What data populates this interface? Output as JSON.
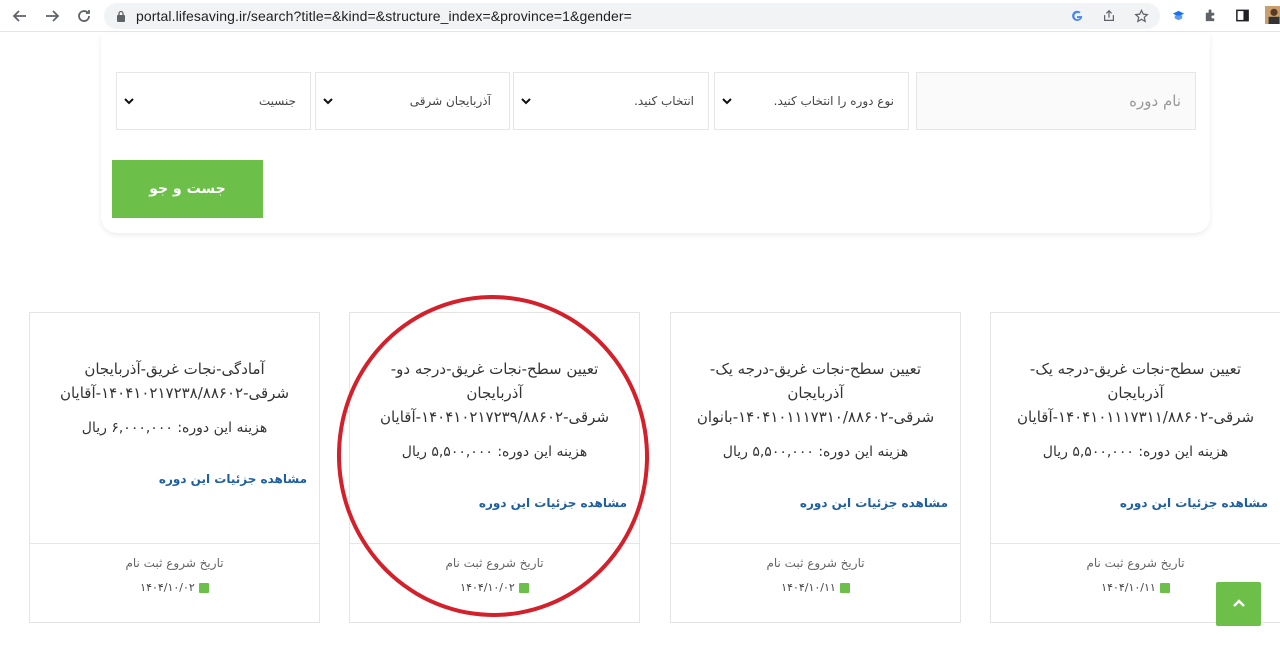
{
  "browser": {
    "url": "portal.lifesaving.ir/search?title=&kind=&structure_index=&province=1&gender="
  },
  "search": {
    "name_placeholder": "نام دوره",
    "kind_select": "نوع دوره را انتخاب کنید.",
    "structure_select": "انتخاب کنید.",
    "province_select": "آذربایجان شرقی",
    "gender_select": "جنسیت",
    "button_label": "جست و جو"
  },
  "cards": [
    {
      "title": "تعیین سطح-نجات غریق-درجه یک-آذربایجان شرقی-۱۴۰۴۱۰۱۱۱۷۳۱۱/۸۸۶۰۲-آقایان",
      "cost": "هزینه این دوره: ۵,۵۰۰,۰۰۰ ریال",
      "link": "مشاهده جزئیات این دوره",
      "reg_label": "تاریخ شروع ثبت نام",
      "reg_date": "۱۴۰۴/۱۰/۱۱"
    },
    {
      "title": "تعیین سطح-نجات غریق-درجه یک-آذربایجان شرقی-۱۴۰۴۱۰۱۱۱۷۳۱۰/۸۸۶۰۲-بانوان",
      "cost": "هزینه این دوره: ۵,۵۰۰,۰۰۰ ریال",
      "link": "مشاهده جزئیات این دوره",
      "reg_label": "تاریخ شروع ثبت نام",
      "reg_date": "۱۴۰۴/۱۰/۱۱"
    },
    {
      "title": "تعیین سطح-نجات غریق-درجه دو-آذربایجان شرقی-۱۴۰۴۱۰۲۱۷۲۳۹/۸۸۶۰۲-آقایان",
      "cost": "هزینه این دوره: ۵,۵۰۰,۰۰۰ ریال",
      "link": "مشاهده جزئیات این دوره",
      "reg_label": "تاریخ شروع ثبت نام",
      "reg_date": "۱۴۰۴/۱۰/۰۲"
    },
    {
      "title": "آمادگی-نجات غریق-آذربایجان شرقی-۱۴۰۴۱۰۲۱۷۲۳۸/۸۸۶۰۲-آقایان",
      "cost": "هزینه این دوره: ۶,۰۰۰,۰۰۰ ریال",
      "link": "مشاهده جزئیات این دوره",
      "reg_label": "تاریخ شروع ثبت نام",
      "reg_date": "۱۴۰۴/۱۰/۰۲"
    }
  ],
  "colors": {
    "accent": "#6cc04a",
    "link": "#1e5fa0",
    "highlight": "#d3202a"
  }
}
